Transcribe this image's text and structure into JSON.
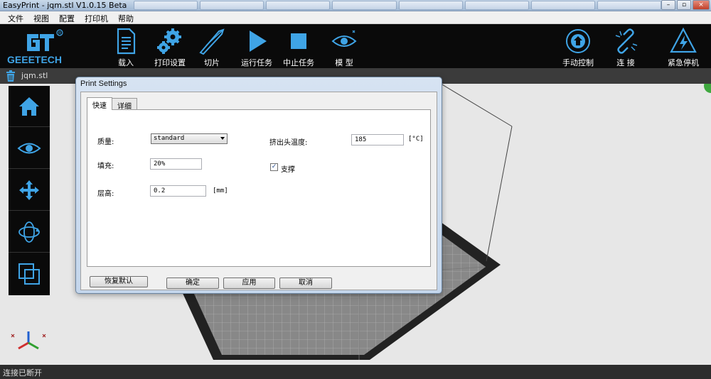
{
  "window": {
    "title": "EasyPrint - jqm.stl    V1.0.15 Beta"
  },
  "menu": [
    "文件",
    "视图",
    "配置",
    "打印机",
    "帮助"
  ],
  "toolbar": {
    "logo_text": "GEEETECH",
    "buttons": [
      {
        "label": "载入",
        "icon": "document-icon"
      },
      {
        "label": "打印设置",
        "icon": "gears-icon"
      },
      {
        "label": "切片",
        "icon": "knife-icon"
      },
      {
        "label": "运行任务",
        "icon": "play-icon"
      },
      {
        "label": "中止任务",
        "icon": "stop-icon"
      },
      {
        "label": "模 型",
        "icon": "eye-icon"
      },
      {
        "label": "手动控制",
        "icon": "manual-control-icon"
      },
      {
        "label": "连 接",
        "icon": "link-icon"
      },
      {
        "label": "紧急停机",
        "icon": "emergency-stop-icon"
      }
    ]
  },
  "file": {
    "name": "jqm.stl"
  },
  "sidebar": [
    "home-icon",
    "eye-icon",
    "move-icon",
    "rotate-icon",
    "scale-icon"
  ],
  "dialog": {
    "title": "Print Settings",
    "tabs": [
      "快速",
      "详细"
    ],
    "quality_label": "质量:",
    "quality_value": "standard",
    "infill_label": "填充:",
    "infill_value": "20%",
    "layer_label": "层高:",
    "layer_value": "0.2",
    "layer_unit": "[mm]",
    "extruder_temp_label": "挤出头温度:",
    "extruder_temp_value": "185",
    "extruder_temp_unit": "[°C]",
    "support_label": "支撑",
    "support_checked": true,
    "buttons": {
      "restore": "恢复默认",
      "ok": "确定",
      "apply": "应用",
      "cancel": "取消"
    }
  },
  "status": {
    "text": "连接已断开"
  },
  "colors": {
    "toolbar_bg": "#0a0a0a",
    "accent_blue": "#3fa4e6"
  }
}
